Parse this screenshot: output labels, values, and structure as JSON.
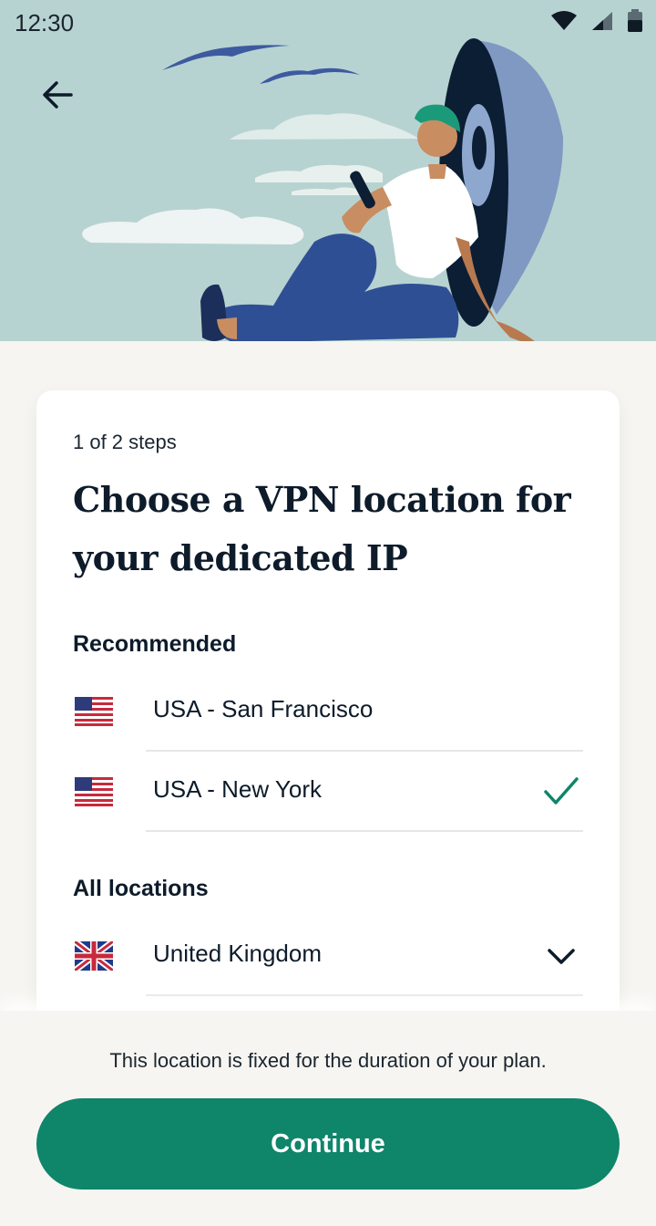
{
  "status_bar": {
    "time": "12:30"
  },
  "header": {
    "back_icon": "arrow-left-icon"
  },
  "card": {
    "steps": "1 of 2 steps",
    "title": "Choose a VPN location for your dedicated IP",
    "recommended_label": "Recommended",
    "recommended": [
      {
        "flag": "us-flag-icon",
        "label": "USA - San Francisco",
        "selected": false
      },
      {
        "flag": "us-flag-icon",
        "label": "USA - New York",
        "selected": true
      }
    ],
    "all_label": "All locations",
    "all": [
      {
        "flag": "uk-flag-icon",
        "label": "United Kingdom",
        "expandable": true
      }
    ]
  },
  "footer": {
    "note": "This location is fixed for the duration of your plan.",
    "cta": "Continue"
  },
  "colors": {
    "accent": "#0f856a",
    "hero_bg": "#b7d3d1",
    "page_bg": "#f6f5f1"
  }
}
